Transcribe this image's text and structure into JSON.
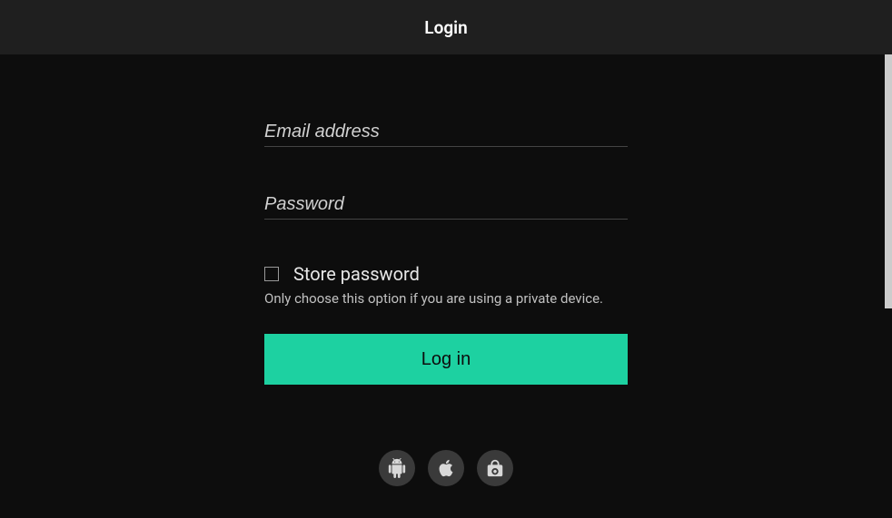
{
  "header": {
    "title": "Login"
  },
  "form": {
    "email_placeholder": "Email address",
    "password_placeholder": "Password",
    "store_password_label": "Store password",
    "store_password_hint": "Only choose this option if you are using a private device.",
    "login_button": "Log in"
  },
  "footer": {
    "icons": [
      "android",
      "apple",
      "camera"
    ]
  }
}
